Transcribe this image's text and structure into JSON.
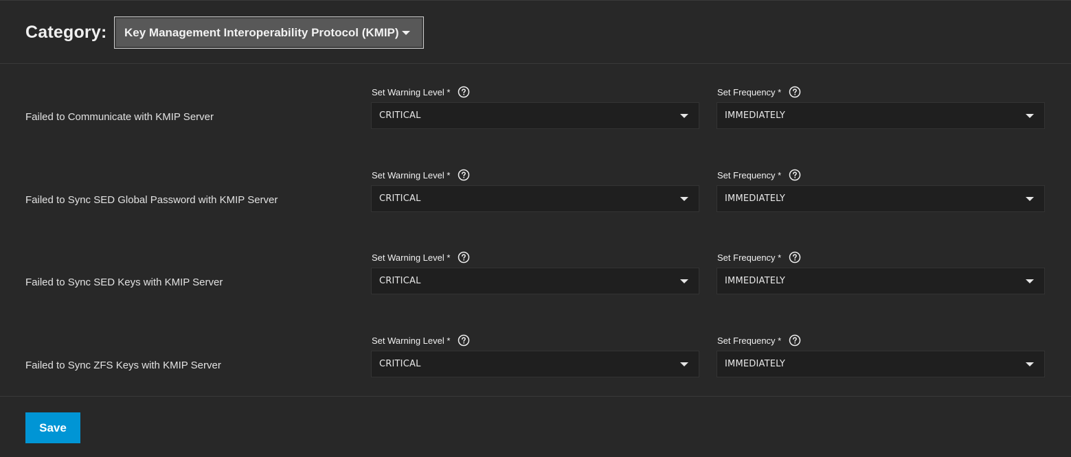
{
  "header": {
    "category_label": "Category:",
    "category_value": "Key Management Interoperability Protocol (KMIP)"
  },
  "alerts": [
    {
      "title": "Failed to Communicate with KMIP Server",
      "warning_label": "Set Warning Level *",
      "warning_value": "CRITICAL",
      "frequency_label": "Set Frequency *",
      "frequency_value": "IMMEDIATELY"
    },
    {
      "title": "Failed to Sync SED Global Password with KMIP Server",
      "warning_label": "Set Warning Level *",
      "warning_value": "CRITICAL",
      "frequency_label": "Set Frequency *",
      "frequency_value": "IMMEDIATELY"
    },
    {
      "title": "Failed to Sync SED Keys with KMIP Server",
      "warning_label": "Set Warning Level *",
      "warning_value": "CRITICAL",
      "frequency_label": "Set Frequency *",
      "frequency_value": "IMMEDIATELY"
    },
    {
      "title": "Failed to Sync ZFS Keys with KMIP Server",
      "warning_label": "Set Warning Level *",
      "warning_value": "CRITICAL",
      "frequency_label": "Set Frequency *",
      "frequency_value": "IMMEDIATELY"
    }
  ],
  "footer": {
    "save_label": "Save"
  },
  "icons": {
    "help": "help-circle-icon",
    "dropdown": "caret-down-icon"
  },
  "colors": {
    "background": "#282828",
    "input_background": "#1f1f1f",
    "accent": "#0095d5"
  }
}
